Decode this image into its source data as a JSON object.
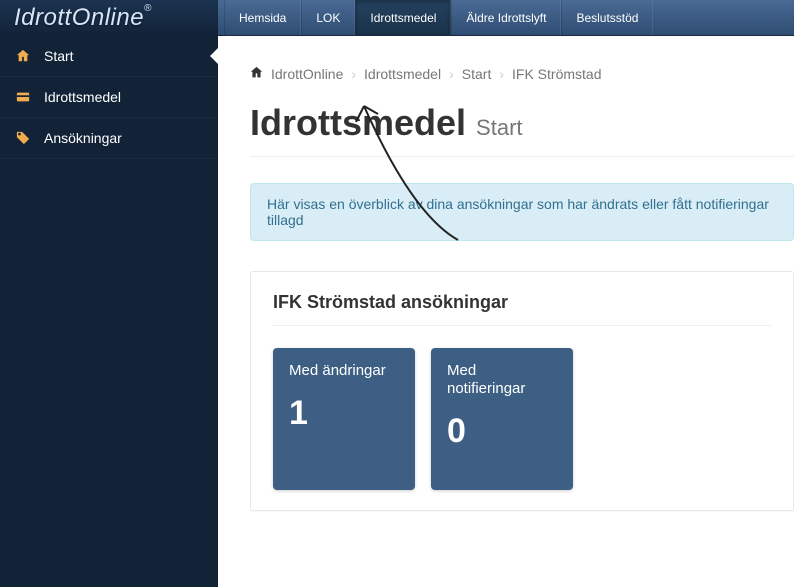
{
  "logo": "IdrottOnline",
  "topnav": {
    "items": [
      {
        "label": "Hemsida"
      },
      {
        "label": "LOK"
      },
      {
        "label": "Idrottsmedel",
        "active": true
      },
      {
        "label": "Äldre Idrottslyft"
      },
      {
        "label": "Beslutsstöd"
      }
    ]
  },
  "sidebar": {
    "items": [
      {
        "icon": "home",
        "label": "Start",
        "active": true
      },
      {
        "icon": "card",
        "label": "Idrottsmedel"
      },
      {
        "icon": "tag",
        "label": "Ansökningar"
      }
    ]
  },
  "breadcrumb": {
    "parts": [
      "IdrottOnline",
      "Idrottsmedel",
      "Start",
      "IFK Strömstad"
    ]
  },
  "page": {
    "title": "Idrottsmedel",
    "subtitle": "Start"
  },
  "alert": {
    "text": "Här visas en överblick av dina ansökningar som har ändrats eller fått notifieringar tillagd"
  },
  "panel": {
    "title": "IFK Strömstad ansökningar",
    "tiles": [
      {
        "label": "Med ändringar",
        "value": "1"
      },
      {
        "label": "Med notifieringar",
        "value": "0"
      }
    ]
  },
  "colors": {
    "tile_bg": "#3d5f83",
    "alert_bg": "#d9edf7",
    "sidebar_bg": "#122338"
  }
}
